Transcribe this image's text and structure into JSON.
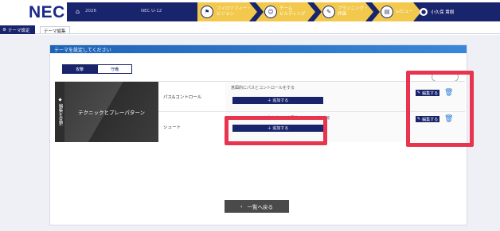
{
  "header": {
    "logo": "NEC",
    "home_icon": "home-icon",
    "year": "2026",
    "team": "NEC U-12",
    "steps": [
      {
        "icon": "flag-icon",
        "label": "フィロソフィー・\nビジョン"
      },
      {
        "icon": "team-icon",
        "label": "チーム\nビルディング"
      },
      {
        "icon": "plan-icon",
        "label": "プランニング・\n評価"
      },
      {
        "icon": "review-icon",
        "label": "レビュー"
      }
    ],
    "user_name": "小久保 貴樹",
    "accent_color": "#18246b",
    "step_color": "#f2c94c"
  },
  "tabs": {
    "active_label": "テーマ設定",
    "second_label": "テーマ編集"
  },
  "panel": {
    "title": "テーマを設定してください",
    "subtabs": [
      "攻撃",
      "守備"
    ],
    "vband_label": "◆ 編集を変更",
    "theme": "テクニックとプレーパターン",
    "rows": [
      {
        "skill": "パス&コントロール",
        "description": "意図的にパスとコントロールをする",
        "add_label": "＋ 追加する",
        "edit_label": "編集する"
      },
      {
        "skill": "シュート",
        "description": "シュートチャンスを逃さずに、意図的にシュートをする",
        "add_label": "＋ 追加する",
        "edit_label": "編集する"
      }
    ],
    "back_label": "一覧へ戻る",
    "highlight_color": "#e8344e"
  }
}
